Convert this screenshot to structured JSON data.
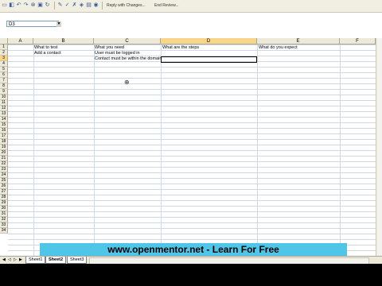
{
  "toolbar": {
    "reply_label": "Reply with Changes...",
    "end_review_label": "End Review..."
  },
  "name_box": {
    "value": "D3"
  },
  "columns": [
    "A",
    "B",
    "C",
    "D",
    "E",
    "F"
  ],
  "rows": [
    "1",
    "2",
    "3",
    "4",
    "5",
    "6",
    "7",
    "8",
    "9",
    "10",
    "11",
    "12",
    "13",
    "14",
    "15",
    "16",
    "17",
    "18",
    "19",
    "20",
    "21",
    "22",
    "23",
    "24",
    "25",
    "26",
    "27",
    "28",
    "29",
    "30",
    "31",
    "32",
    "33",
    "34"
  ],
  "cells": {
    "B1": "What to test",
    "B2": "Add a contact",
    "C1": "What you need",
    "C2": "User must be logged in",
    "C3": "Contact must be within the domain",
    "D1": "What are the steps",
    "E1": "What do you expect"
  },
  "sheet_tabs": [
    "Sheet1",
    "Sheet2",
    "Sheet3"
  ],
  "banner": {
    "text": "www.openmentor.net   -   Learn For Free"
  },
  "colors": {
    "banner": "#4fc5e8",
    "header_active": "#f9d58a"
  }
}
